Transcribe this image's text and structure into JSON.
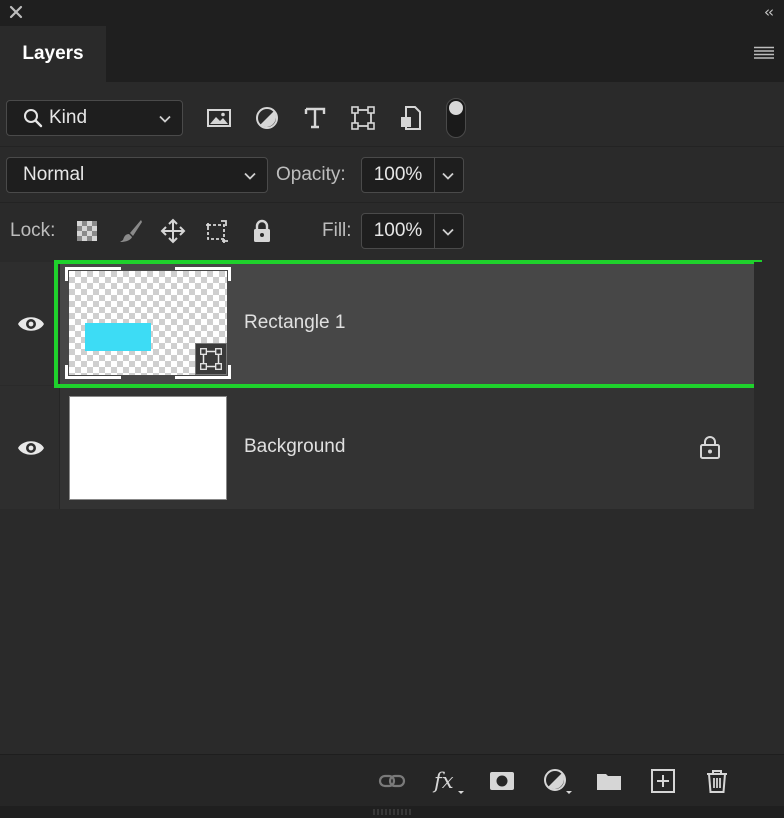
{
  "panel": {
    "tab_label": "Layers"
  },
  "filter_row": {
    "kind_label": "Kind"
  },
  "blend_row": {
    "blend_mode": "Normal",
    "opacity_label": "Opacity:",
    "opacity_value": "100%"
  },
  "lock_row": {
    "lock_label": "Lock:",
    "fill_label": "Fill:",
    "fill_value": "100%"
  },
  "layers": [
    {
      "name": "Rectangle 1",
      "selected": true,
      "visible": true,
      "type": "shape-smart-object"
    },
    {
      "name": "Background",
      "selected": false,
      "visible": true,
      "locked": true
    }
  ],
  "colors": {
    "selection_outline": "#1fd12c",
    "shape_fill": "#3ddcf5",
    "panel_bg": "#2a2a2a",
    "selected_row": "#474747"
  },
  "icons": {
    "titlebar": [
      "close-icon",
      "collapse-icon"
    ],
    "filters": [
      "image-filter-icon",
      "adjustment-filter-icon",
      "type-filter-icon",
      "shape-filter-icon",
      "smart-object-filter-icon"
    ],
    "locks": [
      "lock-transparent-icon",
      "lock-paint-icon",
      "lock-position-icon",
      "lock-artboard-icon",
      "lock-all-icon"
    ],
    "footer": [
      "link-icon",
      "fx-icon",
      "mask-icon",
      "adjustment-layer-icon",
      "group-icon",
      "new-layer-icon",
      "delete-icon"
    ]
  }
}
